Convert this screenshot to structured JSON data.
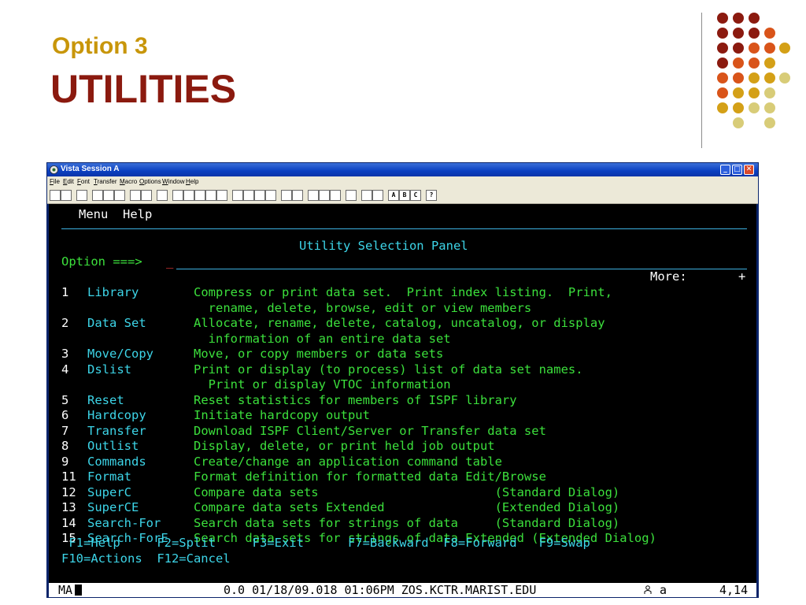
{
  "slide": {
    "subtitle": "Option 3",
    "title": "UTILITIES",
    "dot_colors": {
      "dark_red": "#8b1a0f",
      "orange": "#d9541a",
      "gold": "#d4a017",
      "khaki": "#d8cc78"
    }
  },
  "window": {
    "title": "Vista Session A",
    "min_label": "_",
    "max_label": "□",
    "close_label": "✕",
    "menu": [
      "File",
      "Edit",
      "Font",
      "Transfer",
      "Macro",
      "Options",
      "Window",
      "Help"
    ],
    "toolbar_letter_buttons": [
      "A",
      "B",
      "C",
      "?"
    ]
  },
  "ispf": {
    "menu_items": [
      "Menu",
      "Help"
    ],
    "panel_title": "Utility Selection Panel",
    "option_prompt": "Option ===>",
    "more_label": "More:",
    "more_indicator": "+",
    "options": [
      {
        "num": "1",
        "name": "Library",
        "desc": [
          "Compress or print data set.  Print index listing.  Print,",
          "  rename, delete, browse, edit or view members"
        ]
      },
      {
        "num": "2",
        "name": "Data Set",
        "desc": [
          "Allocate, rename, delete, catalog, uncatalog, or display",
          "  information of an entire data set"
        ]
      },
      {
        "num": "3",
        "name": "Move/Copy",
        "desc": [
          "Move, or copy members or data sets"
        ]
      },
      {
        "num": "4",
        "name": "Dslist",
        "desc": [
          "Print or display (to process) list of data set names.",
          "  Print or display VTOC information"
        ]
      },
      {
        "num": "5",
        "name": "Reset",
        "desc": [
          "Reset statistics for members of ISPF library"
        ]
      },
      {
        "num": "6",
        "name": "Hardcopy",
        "desc": [
          "Initiate hardcopy output"
        ]
      },
      {
        "num": "7",
        "name": "Transfer",
        "desc": [
          "Download ISPF Client/Server or Transfer data set"
        ]
      },
      {
        "num": "8",
        "name": "Outlist",
        "desc": [
          "Display, delete, or print held job output"
        ]
      },
      {
        "num": "9",
        "name": "Commands",
        "desc": [
          "Create/change an application command table"
        ]
      },
      {
        "num": "11",
        "name": "Format",
        "desc": [
          "Format definition for formatted data Edit/Browse"
        ]
      },
      {
        "num": "12",
        "name": "SuperC",
        "desc": [
          "Compare data sets                        (Standard Dialog)"
        ]
      },
      {
        "num": "13",
        "name": "SuperCE",
        "desc": [
          "Compare data sets Extended               (Extended Dialog)"
        ]
      },
      {
        "num": "14",
        "name": "Search-For",
        "desc": [
          "Search data sets for strings of data     (Standard Dialog)"
        ]
      },
      {
        "num": "15",
        "name": "Search-ForE",
        "desc": [
          "Search data sets for strings of data Extended (Extended Dialog)"
        ]
      }
    ],
    "function_keys_line1": " F1=Help     F2=Split     F3=Exit      F7=Backward  F8=Forward   F9=Swap",
    "function_keys_line2": "F10=Actions  F12=Cancel"
  },
  "status": {
    "mode": "MA",
    "info": "0.0 01/18/09.018 01:06PM ZOS.KCTR.MARIST.EDU",
    "session": "a",
    "position": "4,14"
  }
}
